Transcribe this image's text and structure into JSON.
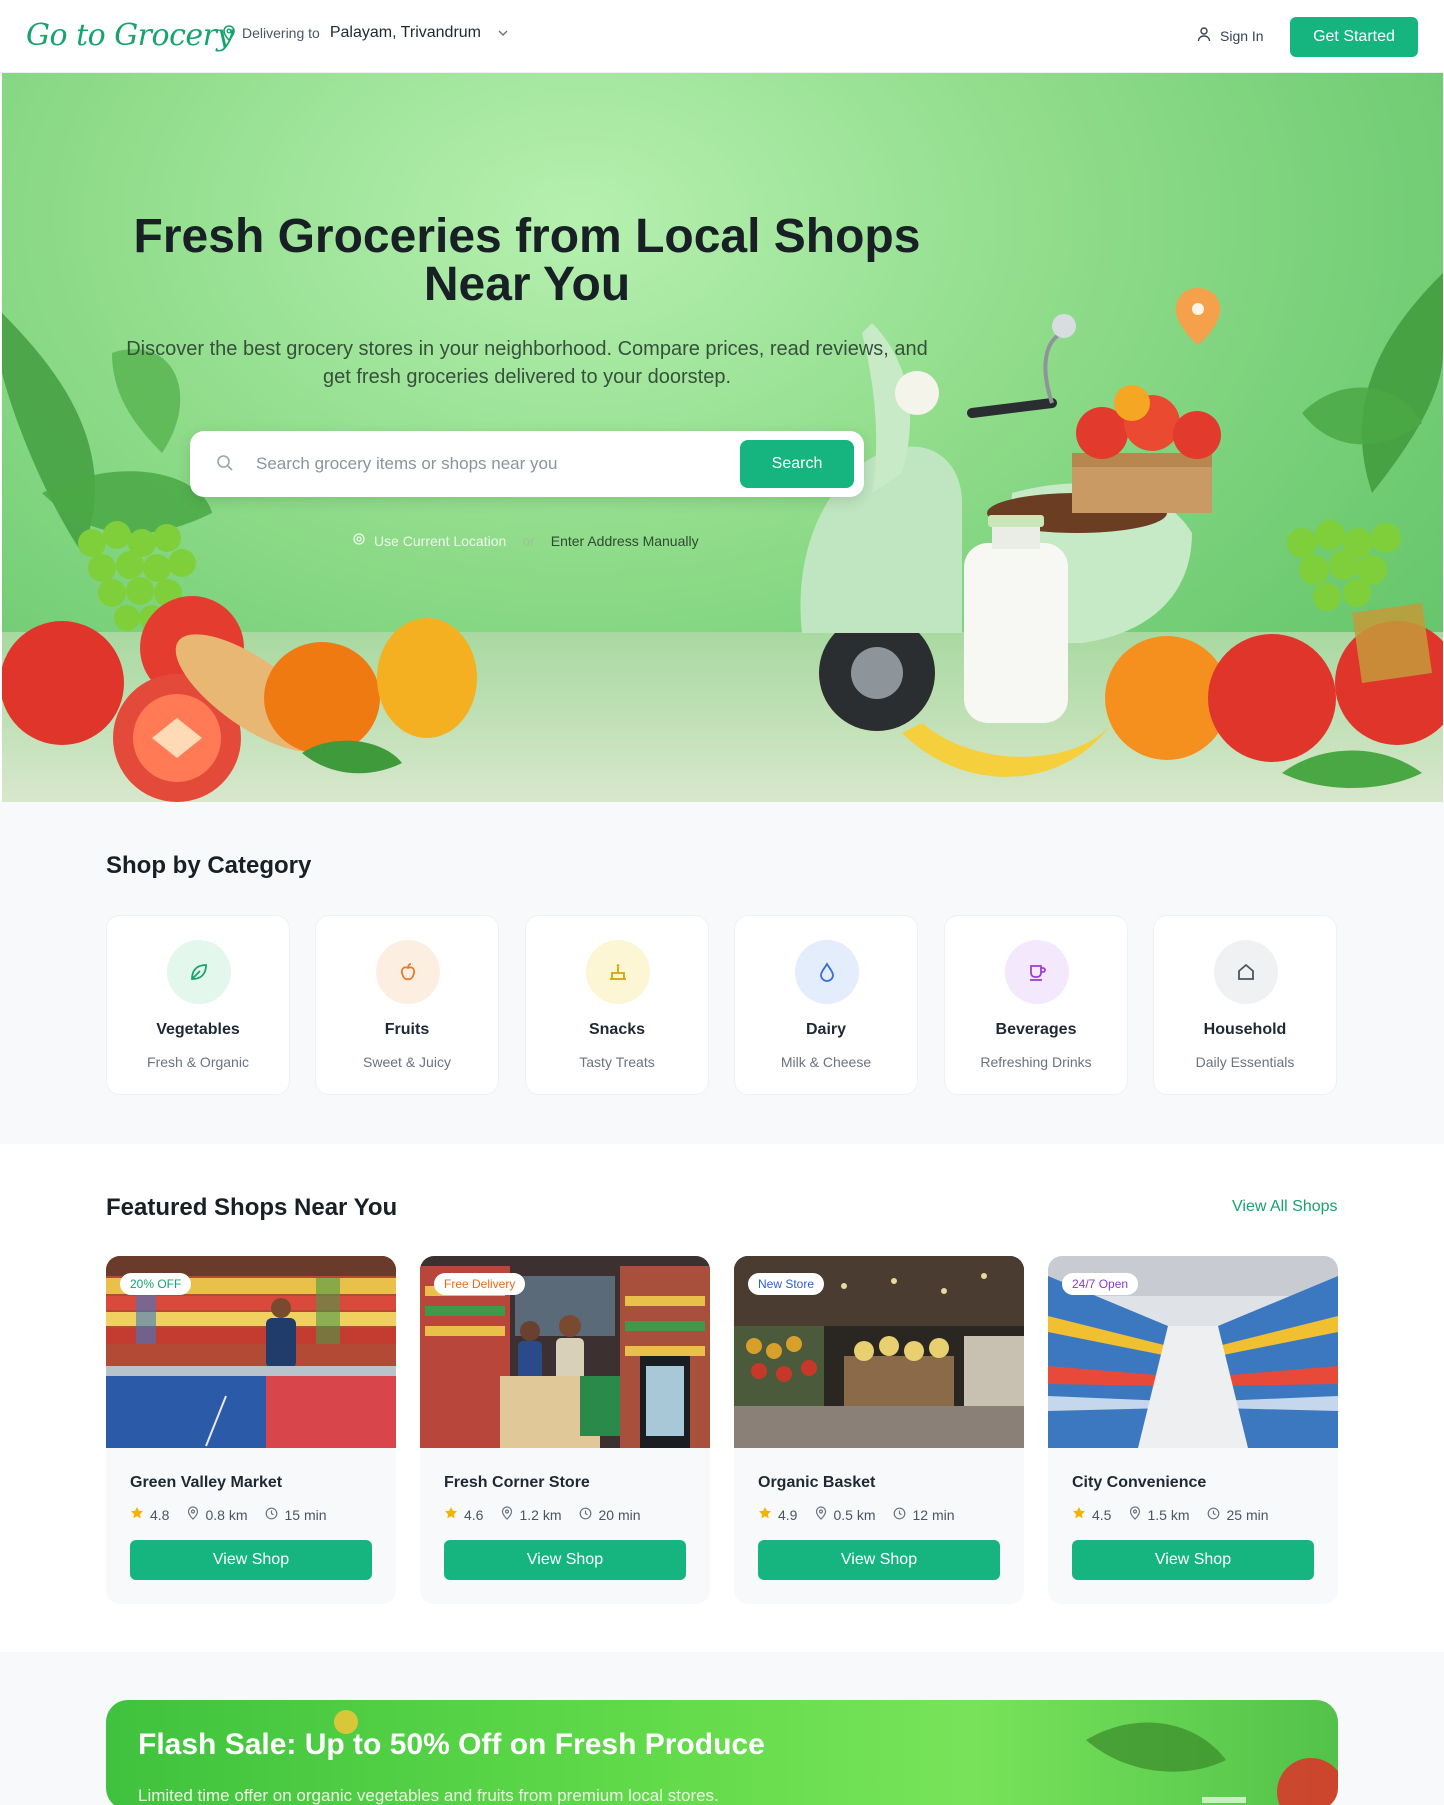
{
  "header": {
    "logo": "Go to Grocery",
    "deliver_label": "Delivering to",
    "location": "Palayam, Trivandrum",
    "sign_in": "Sign In",
    "get_started": "Get Started"
  },
  "hero": {
    "title_line1": "Fresh Groceries from Local Shops",
    "title_line2": "Near You",
    "subtitle": "Discover the best grocery stores in your neighborhood. Compare prices, read reviews, and get fresh groceries delivered to your doorstep.",
    "search_placeholder": "Search grocery items or shops near you",
    "search_button": "Search",
    "use_location": "Use Current Location",
    "or": "or",
    "enter_address": "Enter Address Manually"
  },
  "categories": {
    "title": "Shop by Category",
    "items": [
      {
        "name": "Vegetables",
        "desc": "Fresh & Organic",
        "icon": "leaf-icon",
        "bg": "#e3f7ec",
        "fg": "#16a36e"
      },
      {
        "name": "Fruits",
        "desc": "Sweet & Juicy",
        "icon": "apple-icon",
        "bg": "#fdeee2",
        "fg": "#ea7a2a"
      },
      {
        "name": "Snacks",
        "desc": "Tasty Treats",
        "icon": "cake-icon",
        "bg": "#fdf6d5",
        "fg": "#d4a20c"
      },
      {
        "name": "Dairy",
        "desc": "Milk & Cheese",
        "icon": "drop-icon",
        "bg": "#e4edfc",
        "fg": "#3b6fd8"
      },
      {
        "name": "Beverages",
        "desc": "Refreshing Drinks",
        "icon": "cup-icon",
        "bg": "#f3e8fc",
        "fg": "#9b3fcf"
      },
      {
        "name": "Household",
        "desc": "Daily Essentials",
        "icon": "home-icon",
        "bg": "#eff1f3",
        "fg": "#4b5563"
      }
    ]
  },
  "featured": {
    "title": "Featured Shops Near You",
    "view_all": "View All Shops",
    "shops": [
      {
        "name": "Green Valley Market",
        "badge": "20% OFF",
        "badge_color": "#16a36e",
        "rating": "4.8",
        "distance": "0.8 km",
        "time": "15 min",
        "button": "View Shop"
      },
      {
        "name": "Fresh Corner Store",
        "badge": "Free Delivery",
        "badge_color": "#ea6a1a",
        "rating": "4.6",
        "distance": "1.2 km",
        "time": "20 min",
        "button": "View Shop"
      },
      {
        "name": "Organic Basket",
        "badge": "New Store",
        "badge_color": "#2b5fd0",
        "rating": "4.9",
        "distance": "0.5 km",
        "time": "12 min",
        "button": "View Shop"
      },
      {
        "name": "City Convenience",
        "badge": "24/7 Open",
        "badge_color": "#8a3ad0",
        "rating": "4.5",
        "distance": "1.5 km",
        "time": "25 min",
        "button": "View Shop"
      }
    ]
  },
  "flash": {
    "title": "Flash Sale: Up to 50% Off on Fresh Produce",
    "subtitle": "Limited time offer on organic vegetables and fruits from premium local stores."
  }
}
